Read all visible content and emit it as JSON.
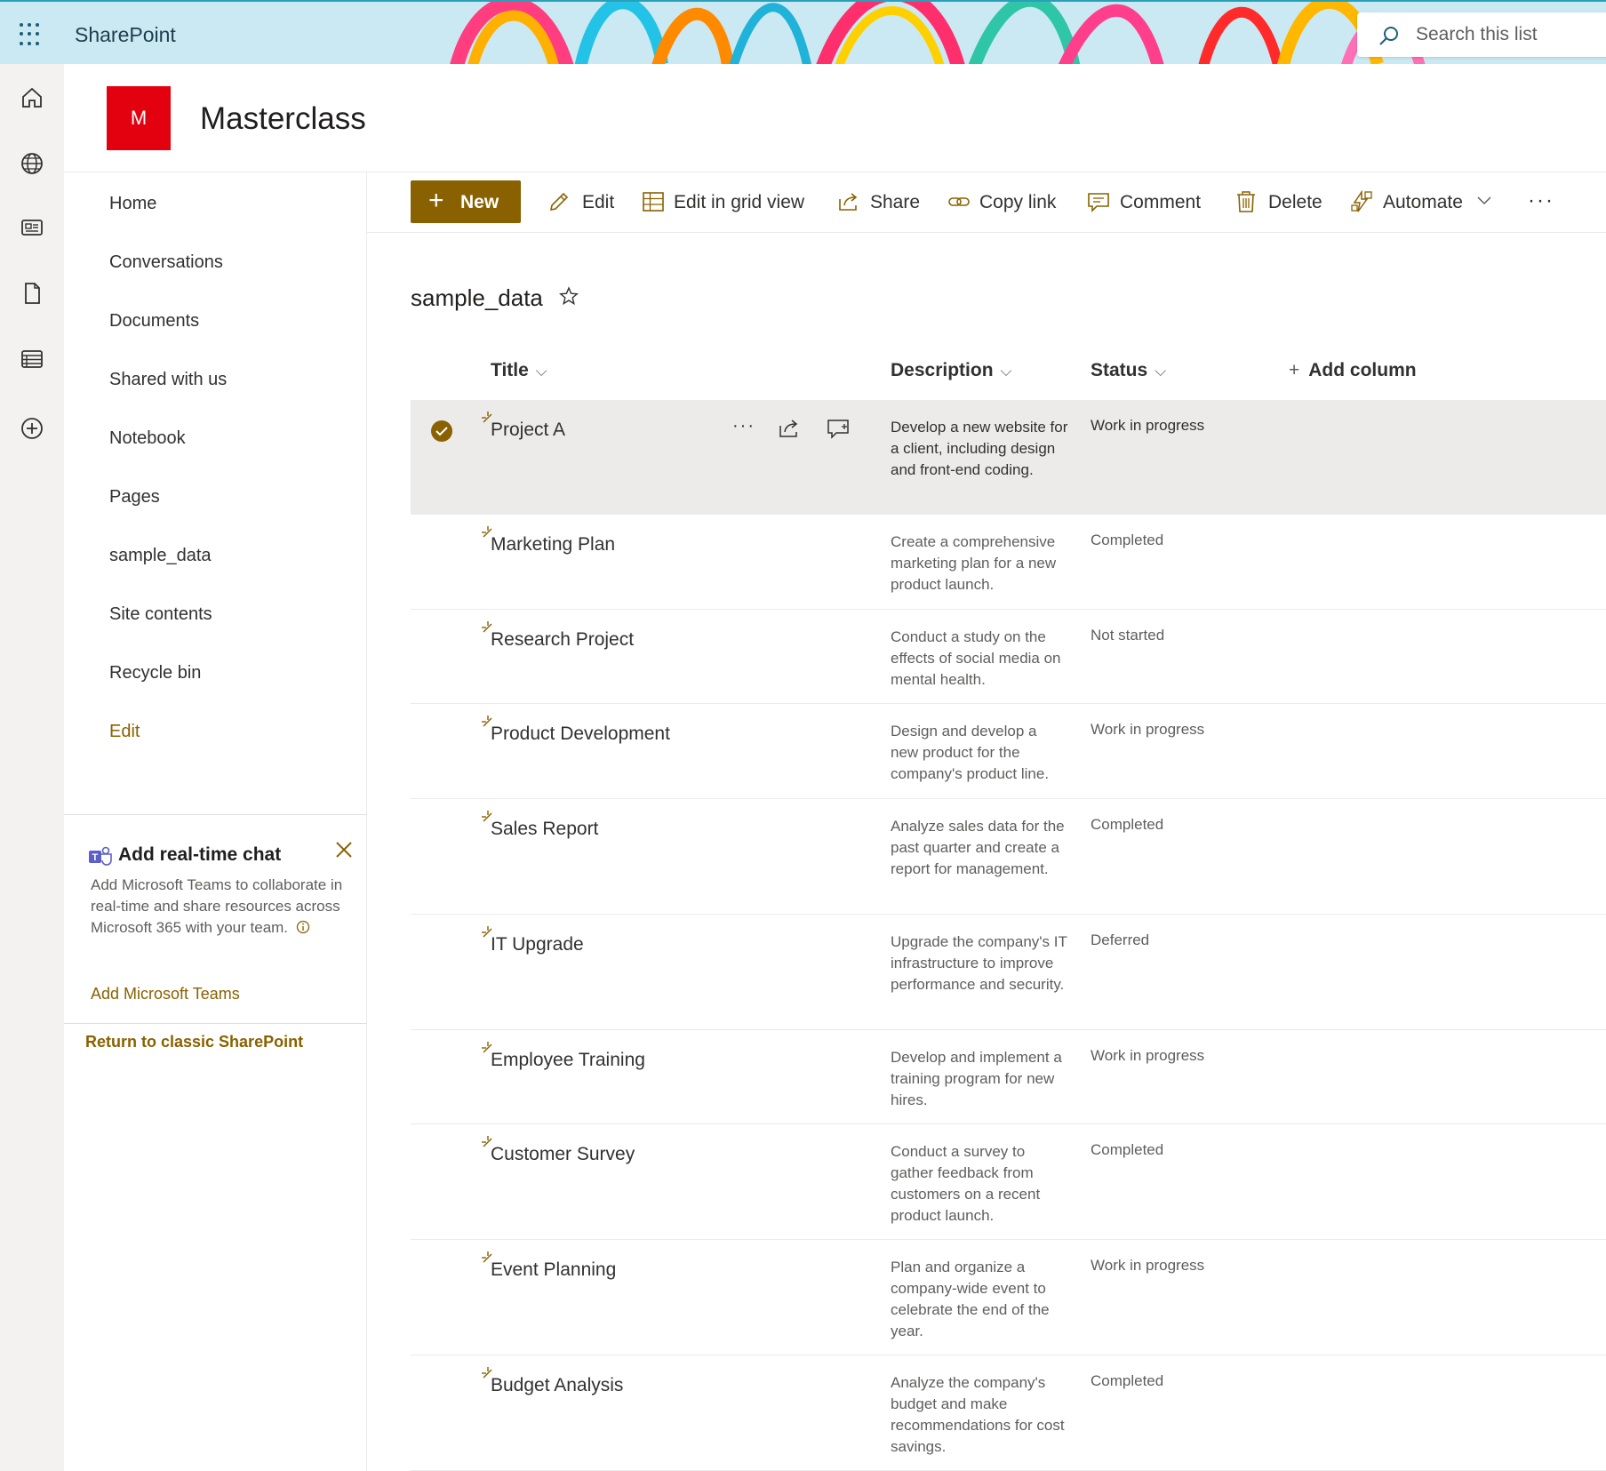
{
  "suite": {
    "app_name": "SharePoint",
    "search_placeholder": "Search this list"
  },
  "site": {
    "logo_letter": "M",
    "logo_color": "#e3000f",
    "title": "Masterclass"
  },
  "nav": {
    "items": [
      {
        "label": "Home"
      },
      {
        "label": "Conversations"
      },
      {
        "label": "Documents"
      },
      {
        "label": "Shared with us"
      },
      {
        "label": "Notebook"
      },
      {
        "label": "Pages"
      },
      {
        "label": "sample_data"
      },
      {
        "label": "Site contents"
      },
      {
        "label": "Recycle bin"
      }
    ],
    "edit_label": "Edit"
  },
  "chat_card": {
    "title": "Add real-time chat",
    "body": "Add Microsoft Teams to collaborate in real-time and share resources across Microsoft 365 with your team.",
    "link": "Add Microsoft Teams"
  },
  "classic_link": "Return to classic SharePoint",
  "commands": {
    "new": "New",
    "edit": "Edit",
    "edit_grid": "Edit in grid view",
    "share": "Share",
    "copy_link": "Copy link",
    "comment": "Comment",
    "delete": "Delete",
    "automate": "Automate",
    "more": "···"
  },
  "list": {
    "title": "sample_data",
    "columns": {
      "title": "Title",
      "description": "Description",
      "status": "Status",
      "add": "Add column"
    },
    "rows": [
      {
        "title": "Project A",
        "description": "Develop a new website for a client, including design and front-end coding.",
        "status": "Work in progress",
        "selected": true
      },
      {
        "title": "Marketing Plan",
        "description": "Create a comprehensive marketing plan for a new product launch.",
        "status": "Completed"
      },
      {
        "title": "Research Project",
        "description": "Conduct a study on the effects of social media on mental health.",
        "status": "Not started"
      },
      {
        "title": "Product Development",
        "description": "Design and develop a new product for the company's product line.",
        "status": "Work in progress"
      },
      {
        "title": "Sales Report",
        "description": "Analyze sales data for the past quarter and create a report for management.",
        "status": "Completed"
      },
      {
        "title": "IT Upgrade",
        "description": "Upgrade the company's IT infrastructure to improve performance and security.",
        "status": "Deferred"
      },
      {
        "title": "Employee Training",
        "description": "Develop and implement a training program for new hires.",
        "status": "Work in progress"
      },
      {
        "title": "Customer Survey",
        "description": "Conduct a survey to gather feedback from customers on a recent product launch.",
        "status": "Completed"
      },
      {
        "title": "Event Planning",
        "description": "Plan and organize a company-wide event to celebrate the end of the year.",
        "status": "Work in progress"
      },
      {
        "title": "Budget Analysis",
        "description": "Analyze the company's budget and make recommendations for cost savings.",
        "status": "Completed"
      }
    ],
    "row_more": "···"
  },
  "colors": {
    "accent": "#8a6100",
    "suitebar": "#cbe9f3"
  }
}
